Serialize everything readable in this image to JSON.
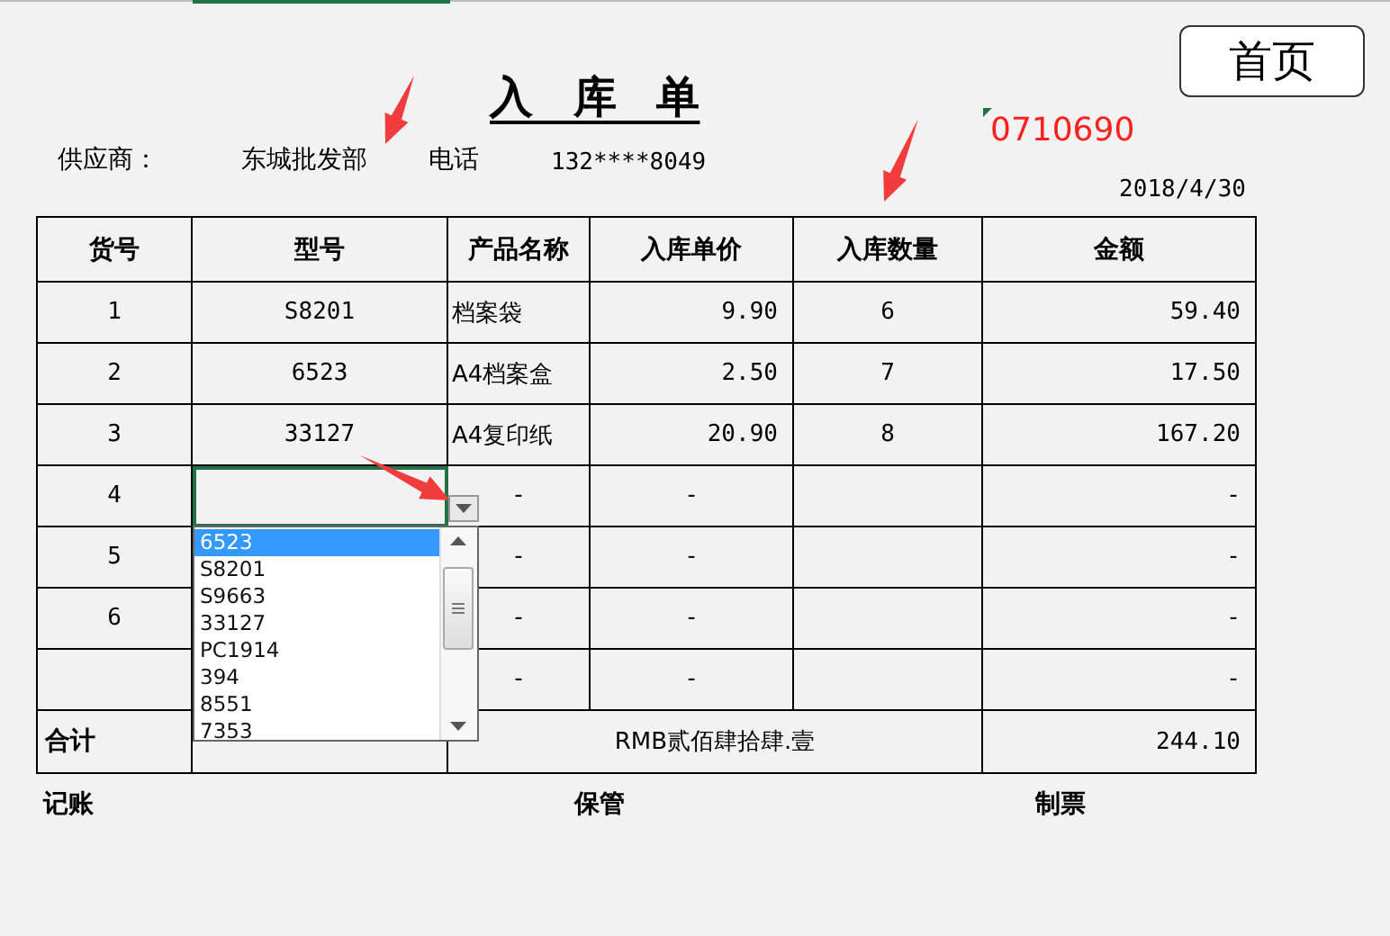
{
  "home_button": "首页",
  "title": "入 库 单",
  "supplier": {
    "label": "供应商：",
    "value": "东城批发部"
  },
  "phone": {
    "label": "电话",
    "value": "132****8049"
  },
  "code": "0710690",
  "date": "2018/4/30",
  "table": {
    "columns": [
      "货号",
      "型号",
      "产品名称",
      "入库单价",
      "入库数量",
      "金额"
    ],
    "rows": [
      {
        "kind": "item",
        "selected": false,
        "cells": [
          "1",
          "S8201",
          "档案袋",
          "9.90",
          "6",
          "59.40"
        ]
      },
      {
        "kind": "item",
        "selected": false,
        "cells": [
          "2",
          "6523",
          "A4档案盒",
          "2.50",
          "7",
          "17.50"
        ]
      },
      {
        "kind": "item",
        "selected": false,
        "cells": [
          "3",
          "33127",
          " A4复印纸",
          "20.90",
          "8",
          "167.20"
        ]
      },
      {
        "kind": "empty",
        "selected": true,
        "cells": [
          "4",
          "",
          "-",
          "-",
          "",
          "-"
        ]
      },
      {
        "kind": "empty",
        "selected": false,
        "cells": [
          "5",
          "",
          "-",
          "-",
          "",
          "-"
        ]
      },
      {
        "kind": "empty",
        "selected": false,
        "cells": [
          "6",
          "",
          "-",
          "-",
          "",
          "-"
        ]
      },
      {
        "kind": "empty",
        "selected": false,
        "cells": [
          "",
          "",
          "-",
          "-",
          "",
          "-"
        ]
      }
    ],
    "total": {
      "label": "合计",
      "words": "RMB贰佰肆拾肆.壹",
      "amount": "244.10"
    }
  },
  "dropdown": {
    "options": [
      {
        "label": "6523",
        "selected": true
      },
      {
        "label": "S8201",
        "selected": false
      },
      {
        "label": "S9663",
        "selected": false
      },
      {
        "label": "33127",
        "selected": false
      },
      {
        "label": "PC1914",
        "selected": false
      },
      {
        "label": "394",
        "selected": false
      },
      {
        "label": "8551",
        "selected": false
      },
      {
        "label": "7353",
        "selected": false
      }
    ]
  },
  "footer": [
    "记账",
    "保管",
    "制票"
  ]
}
